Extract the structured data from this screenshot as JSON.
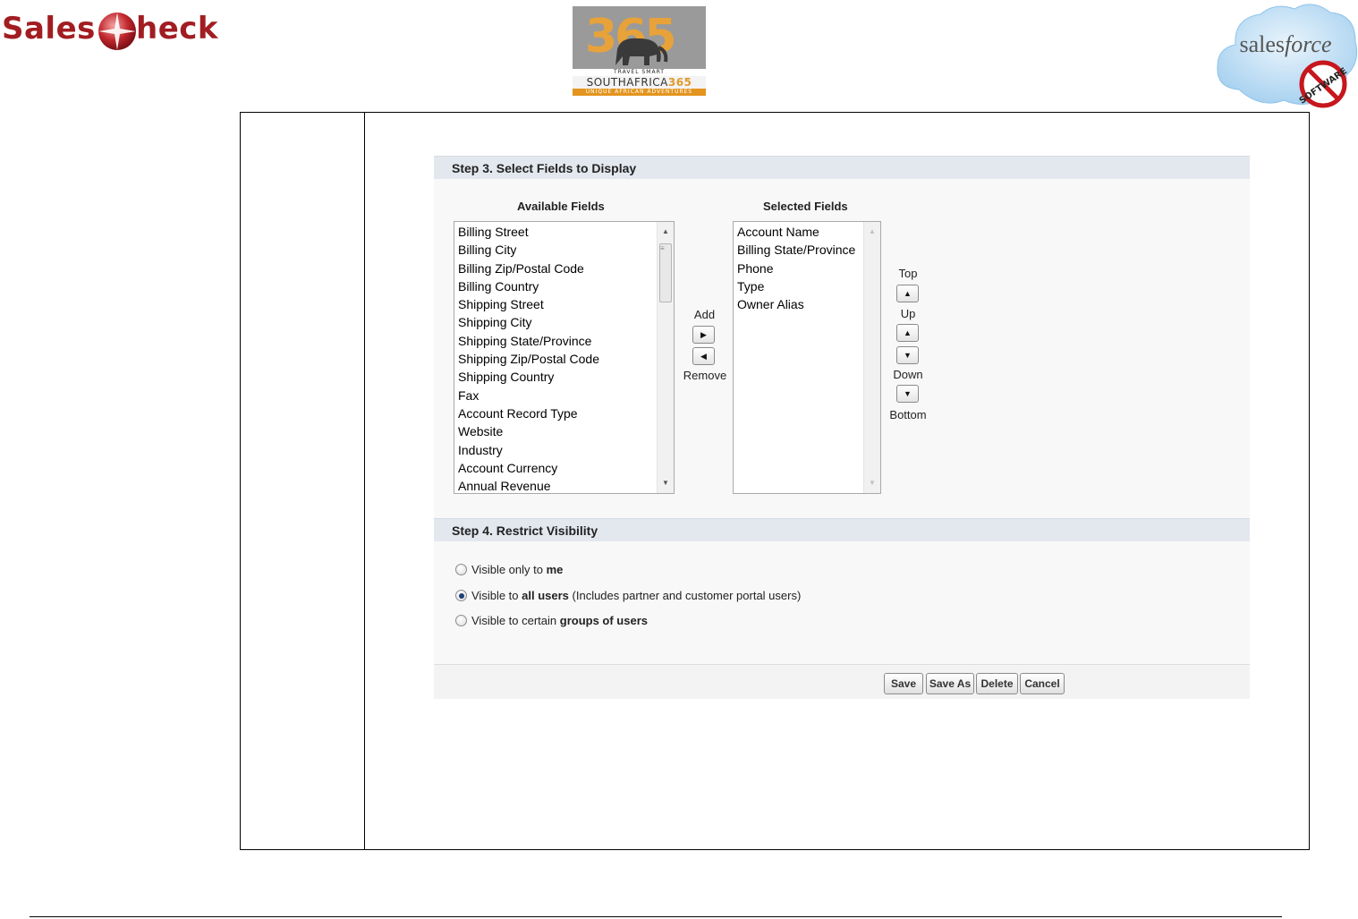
{
  "header": {
    "salescheck": {
      "left": "Sales",
      "right": "heck"
    },
    "sa365": {
      "numbers": "365",
      "tagline": "TRAVEL SMART",
      "name_left": "SOUTHAFRICA",
      "name_right": "365",
      "strap": "UNIQUE AFRICAN ADVENTURES"
    },
    "salesforce": {
      "word": "salesforce",
      "badge": "SOFTWARE"
    }
  },
  "step3": {
    "title": "Step 3. Select Fields to Display",
    "available_title": "Available Fields",
    "selected_title": "Selected Fields",
    "available_fields": [
      "Billing Street",
      "Billing City",
      "Billing Zip/Postal Code",
      "Billing Country",
      "Shipping Street",
      "Shipping City",
      "Shipping State/Province",
      "Shipping Zip/Postal Code",
      "Shipping Country",
      "Fax",
      "Account Record Type",
      "Website",
      "Industry",
      "Account Currency",
      "Annual Revenue"
    ],
    "selected_fields": [
      "Account Name",
      "Billing State/Province",
      "Phone",
      "Type",
      "Owner Alias"
    ],
    "add_label": "Add",
    "remove_label": "Remove",
    "top_label": "Top",
    "up_label": "Up",
    "down_label": "Down",
    "bottom_label": "Bottom"
  },
  "step4": {
    "title": "Step 4. Restrict Visibility",
    "options": [
      {
        "pre": "Visible only to ",
        "bold": "me",
        "post": "",
        "selected": false
      },
      {
        "pre": "Visible to ",
        "bold": "all users",
        "post": " (Includes partner and customer portal users)",
        "selected": true
      },
      {
        "pre": "Visible to certain ",
        "bold": "groups of users",
        "post": "",
        "selected": false
      }
    ]
  },
  "buttons": {
    "save": "Save",
    "save_as": "Save As",
    "delete": "Delete",
    "cancel": "Cancel"
  }
}
